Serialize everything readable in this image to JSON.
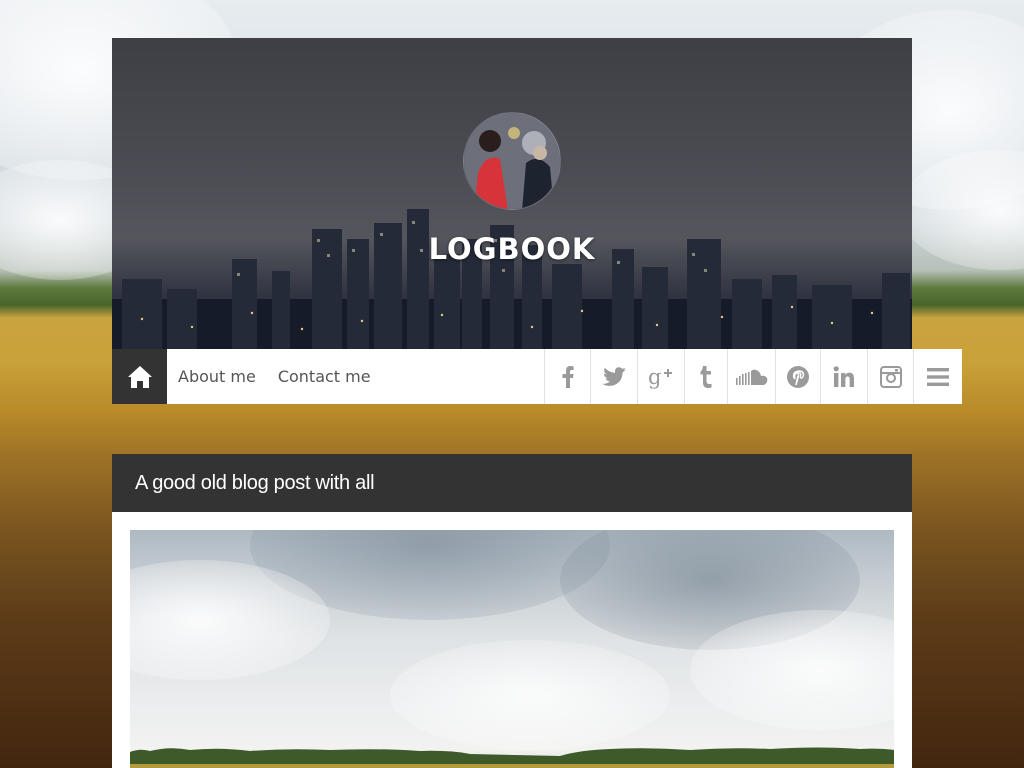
{
  "site": {
    "title": "LOGBOOK"
  },
  "nav": {
    "links": [
      {
        "label": "About me"
      },
      {
        "label": "Contact me"
      }
    ],
    "social": [
      "facebook-icon",
      "twitter-icon",
      "google-plus-icon",
      "tumblr-icon",
      "soundcloud-icon",
      "pinterest-icon",
      "linkedin-icon",
      "instagram-icon"
    ]
  },
  "post": {
    "title": "A good old blog post with all"
  },
  "colors": {
    "nav_dark": "#333333",
    "nav_bg": "#ffffff",
    "icon_grey": "#9a9a9a",
    "link_text": "#555555"
  }
}
